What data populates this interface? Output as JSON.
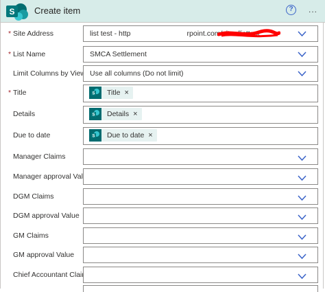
{
  "header": {
    "title": "Create item",
    "logo_icon": "sharepoint-icon",
    "help_icon": "help-circle-icon",
    "more_icon": "more-icon",
    "help_glyph": "?",
    "more_glyph": "..."
  },
  "colors": {
    "header_bg": "#d7ece9",
    "accent": "#036c70",
    "required": "#a4262c",
    "chevron": "#3a63c8",
    "token_bg": "#e6f2f1"
  },
  "fields": [
    {
      "label": "Site Address",
      "required": true,
      "value_left": "list test - http",
      "value_right": "rpoint.com/sites/listtest"
    },
    {
      "label": "List Name",
      "required": true,
      "value": "SMCA Settlement"
    },
    {
      "label": "Limit Columns by View",
      "required": false,
      "value": "Use all columns (Do not limit)"
    },
    {
      "label": "Title",
      "required": true,
      "token": "Title"
    },
    {
      "label": "Details",
      "required": false,
      "token": "Details"
    },
    {
      "label": "Due to date",
      "required": false,
      "token": "Due to date"
    },
    {
      "label": "Manager Claims",
      "required": false,
      "value": ""
    },
    {
      "label": "Manager approval Value",
      "required": false,
      "value": ""
    },
    {
      "label": "DGM Claims",
      "required": false,
      "value": ""
    },
    {
      "label": "DGM approval Value",
      "required": false,
      "value": ""
    },
    {
      "label": "GM Claims",
      "required": false,
      "value": ""
    },
    {
      "label": "GM approval Value",
      "required": false,
      "value": ""
    },
    {
      "label": "Chief Accountant Claims",
      "required": false,
      "value": ""
    }
  ],
  "required_marker": "*",
  "token_remove_glyph": "×"
}
